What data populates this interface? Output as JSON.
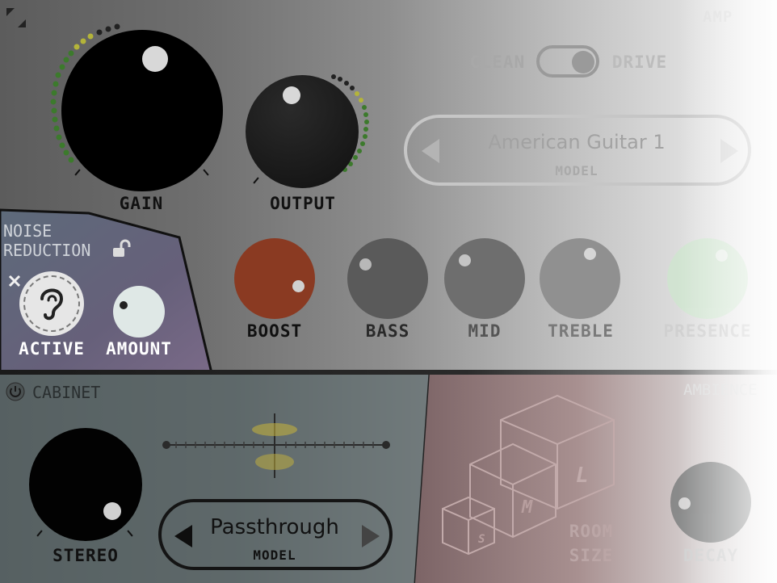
{
  "amp": {
    "section_label": "AMP",
    "clean_label": "CLEAN",
    "drive_label": "DRIVE",
    "gain_label": "GAIN",
    "output_label": "OUTPUT",
    "model_name": "American Guitar 1",
    "model_caption": "MODEL",
    "boost_label": "BOOST",
    "bass_label": "BASS",
    "mid_label": "MID",
    "treble_label": "TREBLE",
    "presence_label": "PRESENCE"
  },
  "noise_reduction": {
    "title_line1": "NOISE",
    "title_line2": "REDUCTION",
    "active_label": "ACTIVE",
    "amount_label": "AMOUNT"
  },
  "cabinet": {
    "title": "CABINET",
    "stereo_label": "STEREO",
    "model_name": "Passthrough",
    "model_caption": "MODEL"
  },
  "ambience": {
    "title": "AMBIENCE",
    "room_size_line1": "ROOM",
    "room_size_line2": "SIZE",
    "decay_label": "DECAY",
    "cube_small": "S",
    "cube_medium": "M",
    "cube_large": "L"
  },
  "icons": {
    "resize": "resize-icon",
    "lock": "unlock-icon",
    "close": "close-icon",
    "ear": "ear-icon",
    "power": "power-icon",
    "prev": "left-arrow-icon",
    "next": "right-arrow-icon"
  },
  "colors": {
    "boost": "#8a3a22",
    "presence": "#cfe6cf",
    "meter_green": "#3c7a2c",
    "meter_yellow": "#b4b43a"
  }
}
